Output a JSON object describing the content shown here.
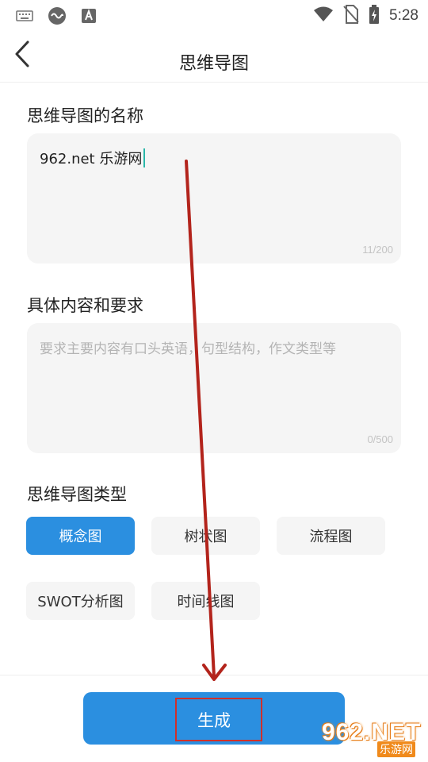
{
  "status_bar": {
    "time": "5:28",
    "left_icons": [
      "keyboard-icon",
      "infinity-app-icon",
      "font-app-icon"
    ],
    "right_icons": [
      "wifi-icon",
      "no-sim-icon",
      "battery-charging-icon"
    ]
  },
  "header": {
    "title": "思维导图",
    "back_icon": "chevron-left-icon"
  },
  "name_field": {
    "label": "思维导图的名称",
    "value": "962.net 乐游网",
    "counter": "11/200"
  },
  "content_field": {
    "label": "具体内容和要求",
    "placeholder": "要求主要内容有口头英语，句型结构，作文类型等",
    "counter": "0/500"
  },
  "type_section": {
    "label": "思维导图类型",
    "options": [
      {
        "label": "概念图",
        "selected": true
      },
      {
        "label": "树状图",
        "selected": false
      },
      {
        "label": "流程图",
        "selected": false
      },
      {
        "label": "SWOT分析图",
        "selected": false
      },
      {
        "label": "时间线图",
        "selected": false
      }
    ]
  },
  "generate_button": {
    "label": "生成"
  },
  "annotation": {
    "arrow_color": "#b3241c",
    "box_color": "#d0302a"
  },
  "watermark": {
    "big": "962.NET",
    "small": "乐游网"
  },
  "colors": {
    "accent": "#2b8fe0",
    "field_bg": "#f5f5f5",
    "cursor": "#2ab7a9"
  }
}
